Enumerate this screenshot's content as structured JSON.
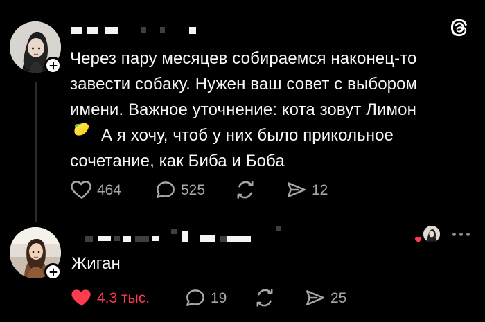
{
  "post": {
    "text_lines": [
      "Через пару месяцев собираемся наконец-то",
      "завести собаку. Нужен ваш совет с выбором",
      "имени. Важное уточнение: кота зовут Лимон",
      "🍋 А я хочу, чтоб у них было прикольное",
      "сочетание, как Биба и Боба"
    ],
    "line4_text": "А я хочу, чтоб у них было прикольное",
    "likes": "464",
    "comments": "525",
    "shares": "12"
  },
  "reply": {
    "text": "Жиган",
    "likes": "4.3 тыс.",
    "comments": "19",
    "shares": "25"
  },
  "icons": {
    "threads": "threads-logo-icon",
    "heart": "heart-icon",
    "comment": "comment-icon",
    "repost": "repost-icon",
    "send": "send-icon",
    "lemon": "lemon-emoji-icon",
    "more": "more-icon",
    "plus": "plus-icon"
  },
  "colors": {
    "background": "#000000",
    "text": "#f7f7f7",
    "muted": "#a7a7a7",
    "like_active": "#ff3b4f"
  }
}
